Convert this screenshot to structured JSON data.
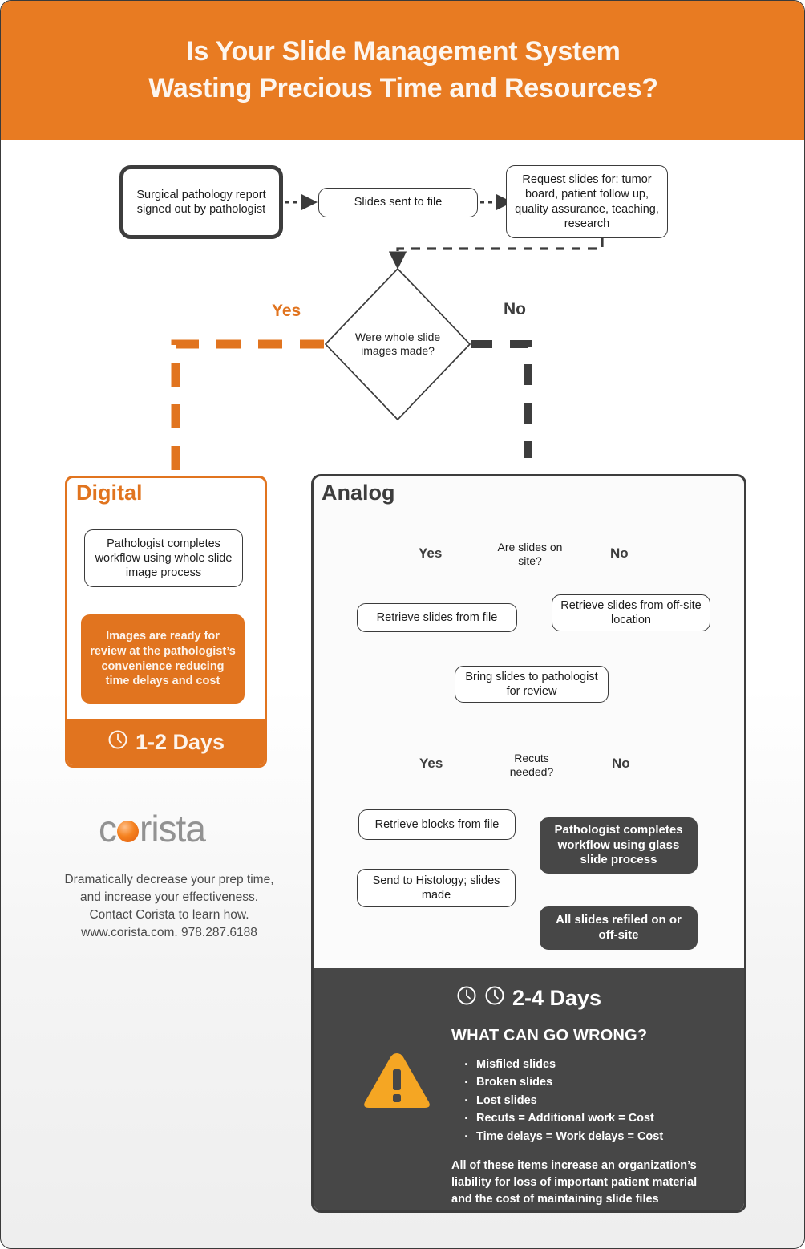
{
  "header": {
    "line1": "Is Your Slide Management System",
    "line2": "Wasting Precious Time and Resources?",
    "bg_color": "#e87b22"
  },
  "colors": {
    "orange": "#e1741f",
    "dark_gray": "#474747",
    "warning_amber": "#f5a623",
    "logo_gray": "#929292"
  },
  "flow_top": {
    "node_report": "Surgical pathology report signed out by pathologist",
    "node_file": "Slides sent to file",
    "node_request": "Request slides for: tumor board, patient follow up, quality assurance, teaching, research",
    "decision": "Were whole slide images made?",
    "branch_yes": "Yes",
    "branch_no": "No"
  },
  "digital": {
    "title": "Digital",
    "node_workflow": "Pathologist completes workflow using whole slide image process",
    "node_result": "Images are ready for review at the pathologist’s convenience reducing time delays and cost",
    "days_label": "1-2 Days",
    "clock_icon": "clock-icon"
  },
  "analog": {
    "title": "Analog",
    "decision_onsite": "Are slides on site?",
    "onsite_yes": "Yes",
    "onsite_no": "No",
    "node_retrieve_file": "Retrieve slides from file",
    "node_retrieve_offsite": "Retrieve slides from off-site location",
    "node_bring": "Bring slides to pathologist for review",
    "decision_recuts": "Recuts needed?",
    "recuts_yes": "Yes",
    "recuts_no": "No",
    "node_retrieve_blocks": "Retrieve blocks from file",
    "node_histology": "Send to Histology; slides made",
    "node_glass_workflow": "Pathologist completes workflow using glass slide process",
    "node_refiled": "All slides refiled on or off-site",
    "days_label": "2-4 Days",
    "clock_icon": "clock-icon",
    "warning_icon": "warning-triangle-icon",
    "wrong_title": "WHAT CAN GO WRONG?",
    "wrong_items": [
      "Misfiled slides",
      "Broken slides",
      "Lost slides",
      "Recuts = Additional work = Cost",
      "Time delays = Work delays = Cost"
    ],
    "wrong_note": "All of these items increase an organization’s liability for loss of important patient material and the cost of maintaining slide files"
  },
  "brand": {
    "logo_pre": "c",
    "logo_dot": "logo-dot-icon",
    "logo_post": "rista",
    "tagline_line1": "Dramatically decrease your prep time,",
    "tagline_line2": "and increase your effectiveness.",
    "tagline_line3": "Contact Corista to learn how.",
    "tagline_line4": "www.corista.com. 978.287.6188"
  }
}
